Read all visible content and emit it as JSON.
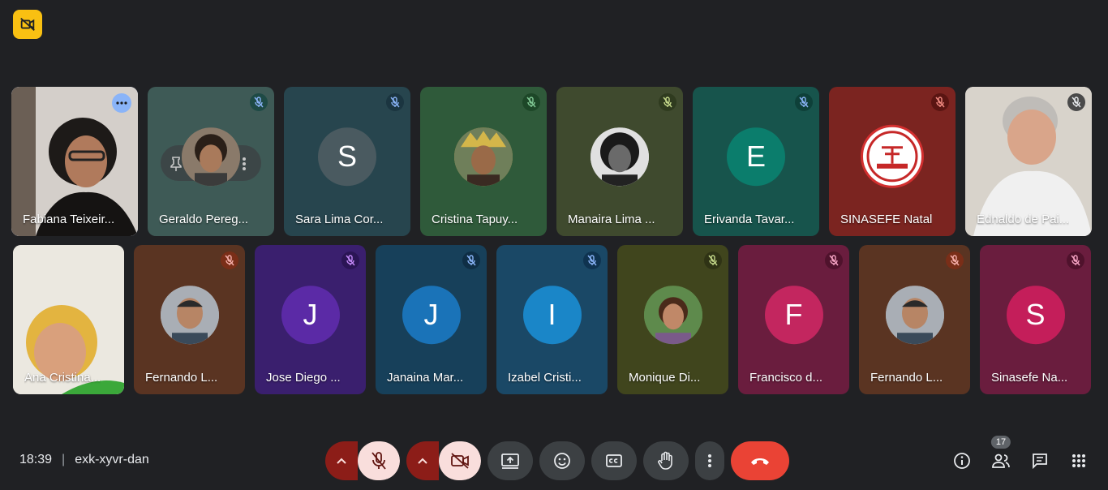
{
  "meeting": {
    "time": "18:39",
    "separator": "|",
    "code": "exk-xyvr-dan"
  },
  "participants_count": "17",
  "row1": [
    {
      "name": "Fabiana Teixeir...",
      "bg": "#c9c3bf",
      "avatar_type": "photo",
      "status": "active"
    },
    {
      "name": "Geraldo Pereg...",
      "bg": "#3e5a56",
      "avatar_type": "photo",
      "mute_bg": "#1e4a45"
    },
    {
      "name": "Sara Lima Cor...",
      "bg": "#27454e",
      "avatar_type": "letter",
      "letter": "S",
      "avatar_color": "#4a5a60",
      "mute_bg": "#1b3540"
    },
    {
      "name": "Cristina Tapuy...",
      "bg": "#2f5a3a",
      "avatar_type": "photo",
      "mute_bg": "#1d4728"
    },
    {
      "name": "Manaira Lima ...",
      "bg": "#3f4a2e",
      "avatar_type": "photo",
      "mute_bg": "#2f3b1f"
    },
    {
      "name": "Erivanda Tavar...",
      "bg": "#17544c",
      "avatar_type": "letter",
      "letter": "E",
      "avatar_color": "#0b7d6c",
      "mute_bg": "#0e4039"
    },
    {
      "name": "SINASEFE Natal",
      "bg": "#7b2420",
      "avatar_type": "logo",
      "mute_bg": "#5a1512"
    },
    {
      "name": "Ednaldo de Pai...",
      "bg": "#d9d5cf",
      "avatar_type": "photo",
      "mute_bg": "#4a4a4a"
    }
  ],
  "row2": [
    {
      "name": "Ana Cristina...",
      "bg": "#e9e6de",
      "avatar_type": "photo"
    },
    {
      "name": "Fernando L...",
      "bg": "#5a3422",
      "avatar_type": "photo",
      "mute_bg": "#7a2e18"
    },
    {
      "name": "Jose Diego ...",
      "bg": "#3a1f6e",
      "avatar_type": "letter",
      "letter": "J",
      "avatar_color": "#5b2aa6",
      "mute_bg": "#2b1555"
    },
    {
      "name": "Janaina Mar...",
      "bg": "#17405a",
      "avatar_type": "letter",
      "letter": "J",
      "avatar_color": "#1a73b8",
      "mute_bg": "#0f2e45"
    },
    {
      "name": "Izabel Cristi...",
      "bg": "#1a4866",
      "avatar_type": "letter",
      "letter": "I",
      "avatar_color": "#1a86c8",
      "mute_bg": "#0f3350"
    },
    {
      "name": "Monique Di...",
      "bg": "#40451d",
      "avatar_type": "photo",
      "mute_bg": "#2f3315"
    },
    {
      "name": "Francisco d...",
      "bg": "#6a1d3e",
      "avatar_type": "letter",
      "letter": "F",
      "avatar_color": "#c3265f",
      "mute_bg": "#4f122c"
    },
    {
      "name": "Fernando L...",
      "bg": "#5a3422",
      "avatar_type": "photo",
      "mute_bg": "#7a2e18"
    },
    {
      "name": "Sinasefe Na...",
      "bg": "#6a1d3e",
      "avatar_type": "letter",
      "letter": "S",
      "avatar_color": "#c41e5a",
      "mute_bg": "#4f122c"
    }
  ],
  "icons": {
    "top": "camera-off-icon",
    "controls": [
      "chevron-up-icon",
      "mic-off-icon",
      "chevron-up-icon",
      "camera-off-icon",
      "present-screen-icon",
      "emoji-icon",
      "captions-icon",
      "raise-hand-icon",
      "more-options-icon",
      "hang-up-icon"
    ],
    "right": [
      "info-icon",
      "people-icon",
      "chat-icon",
      "apps-icon"
    ]
  }
}
